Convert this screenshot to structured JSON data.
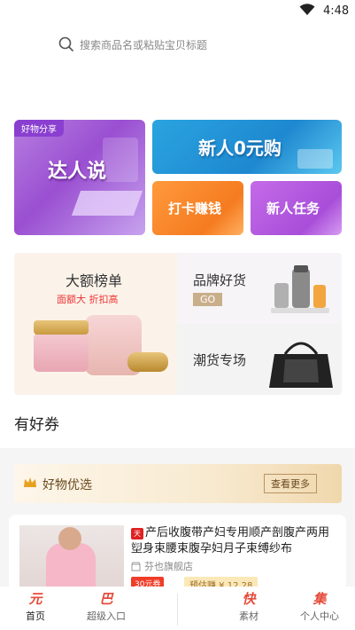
{
  "status": {
    "time": "4:48"
  },
  "search": {
    "placeholder": "搜索商品名或粘贴宝贝标题"
  },
  "banners": {
    "daren": {
      "tag": "好物分享",
      "title": "达人说"
    },
    "new_user": {
      "title": "新人0元购"
    },
    "checkin": {
      "title": "打卡赚钱"
    },
    "new_task": {
      "title": "新人任务"
    }
  },
  "promo": {
    "big_list": {
      "title": "大额榜单",
      "subtitle": "面额大  折扣高"
    },
    "brand": {
      "title": "品牌好货",
      "go": "GO"
    },
    "trend": {
      "title": "潮货专场"
    }
  },
  "coupon_section": {
    "title": "有好券"
  },
  "good_goods": {
    "label": "好物优选",
    "more": "查看更多"
  },
  "product": {
    "tmall_mark": "天猫",
    "name": "产后收腹带产妇专用顺产剖腹产两用塑身束腰束腹孕妇月子束缚纱布",
    "shop": "芬也旗舰店",
    "badge_coupon": "30元券",
    "badge_earn": "预估赚 ¥ 12.28"
  },
  "tabs": [
    {
      "icon": "元",
      "label": "首页"
    },
    {
      "icon": "巴",
      "label": "超级入口"
    },
    {
      "icon": "快",
      "label": "素材"
    },
    {
      "icon": "集",
      "label": "个人中心"
    }
  ],
  "colors": {
    "accent": "#e54b3a",
    "gold": "#c9ae8a"
  }
}
